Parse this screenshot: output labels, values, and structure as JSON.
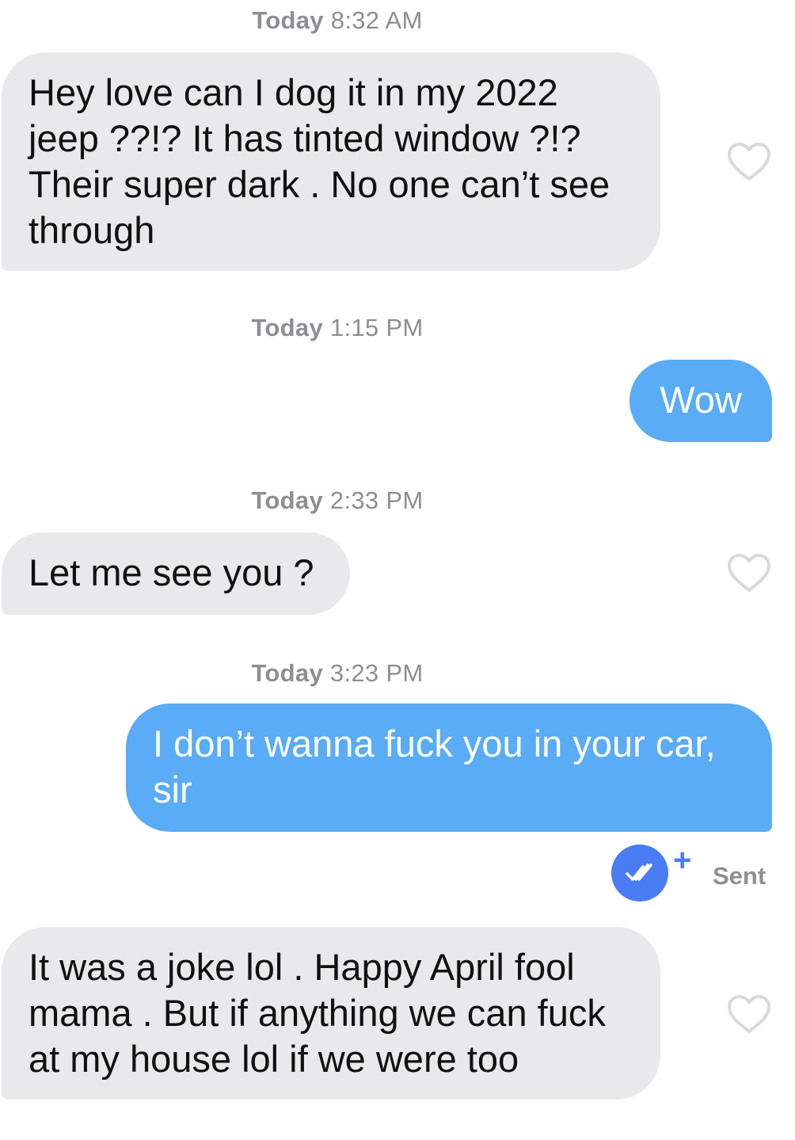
{
  "conversation": [
    {
      "stamp_day": "Today",
      "stamp_time": "8:32 AM",
      "direction": "incoming",
      "text": "Hey love can I dog it in my 2022 jeep ??!? It has tinted window ?!? Their super dark . No one can’t see through"
    },
    {
      "stamp_day": "Today",
      "stamp_time": "1:15 PM",
      "direction": "outgoing",
      "text": "Wow"
    },
    {
      "stamp_day": "Today",
      "stamp_time": "2:33 PM",
      "direction": "incoming",
      "text": "Let me see you ?"
    },
    {
      "stamp_day": "Today",
      "stamp_time": "3:23 PM",
      "direction": "outgoing",
      "text": "I don’t wanna fuck you in your car, sir"
    },
    {
      "direction": "incoming",
      "text": "It was a joke lol . Happy April fool mama . But if anything we can fuck at my house lol if we were too"
    }
  ],
  "delivery": {
    "status_label": "Sent",
    "status_icon": "double-check-icon",
    "plus_label": "+"
  },
  "icons": {
    "like": "heart-outline-icon"
  },
  "colors": {
    "incoming_bubble": "#e9e9eb",
    "outgoing_bubble": "#59acf5",
    "timestamp": "#8e8e93",
    "accent": "#4a7cf6",
    "heart_outline": "#d9d9dc"
  }
}
